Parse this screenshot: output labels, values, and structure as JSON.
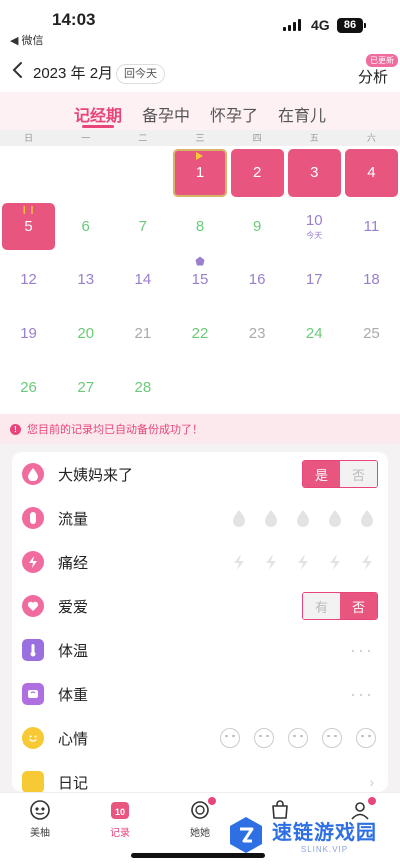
{
  "status_bar": {
    "time": "14:03",
    "back_app": "◀ 微信",
    "network": "4G",
    "battery": "86"
  },
  "header": {
    "month_title": "2023 年 2月",
    "today_button": "回今天",
    "analysis": "分析",
    "updated_badge": "已更新"
  },
  "tabs": [
    {
      "label": "记经期",
      "active": true
    },
    {
      "label": "备孕中",
      "active": false
    },
    {
      "label": "怀孕了",
      "active": false
    },
    {
      "label": "在育儿",
      "active": false
    }
  ],
  "weekdays": [
    "日",
    "一",
    "二",
    "三",
    "四",
    "五",
    "六"
  ],
  "calendar": {
    "leading_blanks": 3,
    "days": [
      {
        "n": "1",
        "type": "period",
        "current": true,
        "marker": "start-flag"
      },
      {
        "n": "2",
        "type": "period"
      },
      {
        "n": "3",
        "type": "period"
      },
      {
        "n": "4",
        "type": "period"
      },
      {
        "n": "5",
        "type": "period",
        "marker": "end-pause"
      },
      {
        "n": "6",
        "type": "fertile"
      },
      {
        "n": "7",
        "type": "fertile"
      },
      {
        "n": "8",
        "type": "fertile"
      },
      {
        "n": "9",
        "type": "fertile"
      },
      {
        "n": "10",
        "type": "normal",
        "sub": "今天"
      },
      {
        "n": "11",
        "type": "normal"
      },
      {
        "n": "12",
        "type": "normal"
      },
      {
        "n": "13",
        "type": "normal"
      },
      {
        "n": "14",
        "type": "normal"
      },
      {
        "n": "15",
        "type": "normal",
        "marker": "ovulation"
      },
      {
        "n": "16",
        "type": "normal"
      },
      {
        "n": "17",
        "type": "normal"
      },
      {
        "n": "18",
        "type": "normal"
      },
      {
        "n": "19",
        "type": "normal"
      },
      {
        "n": "20",
        "type": "fertile"
      },
      {
        "n": "21",
        "type": "grey"
      },
      {
        "n": "22",
        "type": "fertile"
      },
      {
        "n": "23",
        "type": "grey"
      },
      {
        "n": "24",
        "type": "fertile"
      },
      {
        "n": "25",
        "type": "grey"
      },
      {
        "n": "26",
        "type": "fertile"
      },
      {
        "n": "27",
        "type": "fertile"
      },
      {
        "n": "28",
        "type": "fertile"
      }
    ]
  },
  "notice": {
    "text": "您目前的记录均已自动备份成功了！"
  },
  "records": {
    "period": {
      "label": "大姨妈来了",
      "yes": "是",
      "no": "否",
      "selected": "yes"
    },
    "flow": {
      "label": "流量",
      "levels": 5,
      "selected": 0
    },
    "pain": {
      "label": "痛经",
      "levels": 5,
      "selected": 0
    },
    "love": {
      "label": "爱爱",
      "yes": "有",
      "no": "否",
      "selected": "no"
    },
    "temperature": {
      "label": "体温",
      "more": "···"
    },
    "weight": {
      "label": "体重",
      "more": "···"
    },
    "mood": {
      "label": "心情",
      "options": [
        "happy",
        "neutral",
        "meh",
        "sad",
        "crying"
      ]
    },
    "diary": {
      "label": "日记"
    }
  },
  "tabbar": [
    {
      "label": "美柚",
      "icon": "home-icon",
      "active": false,
      "dot": false
    },
    {
      "label": "记录",
      "icon": "calendar-10-icon",
      "active": true,
      "dot": false
    },
    {
      "label": "她她",
      "icon": "community-icon",
      "active": false,
      "dot": true
    },
    {
      "label": "",
      "icon": "shop-icon",
      "active": false,
      "dot": false
    },
    {
      "label": "",
      "icon": "profile-icon",
      "active": false,
      "dot": true
    }
  ],
  "watermark": {
    "title": "速链游戏园",
    "sub": "SLINK.VIP"
  },
  "colors": {
    "accent": "#e8467a",
    "period": "#e8557f",
    "fertile": "#6cc97a",
    "normal": "#9a7fcf"
  }
}
